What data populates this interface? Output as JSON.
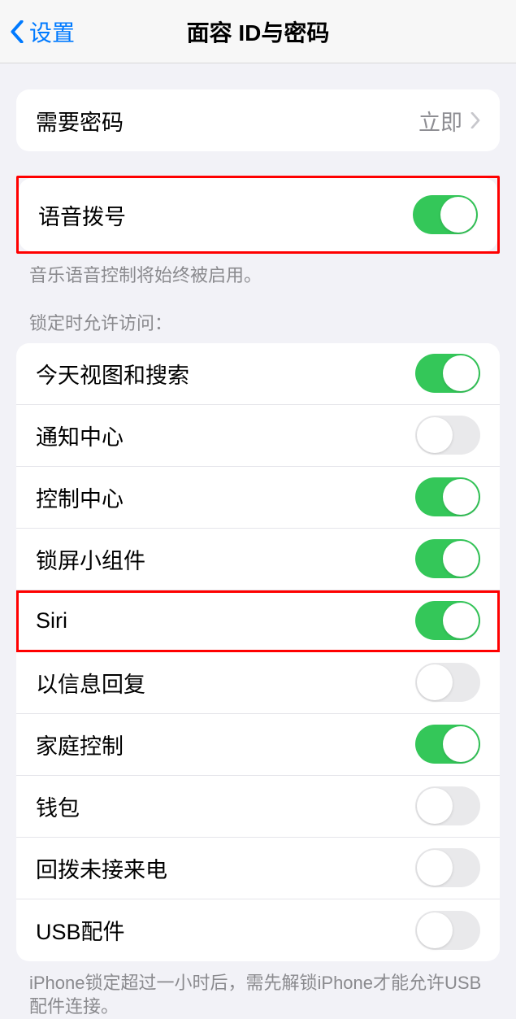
{
  "header": {
    "back_label": "设置",
    "title": "面容 ID与密码"
  },
  "passcode_row": {
    "label": "需要密码",
    "value": "立即"
  },
  "voice_dial": {
    "label": "语音拨号",
    "on": true,
    "footer": "音乐语音控制将始终被启用。"
  },
  "lockscreen": {
    "section_header": "锁定时允许访问：",
    "items": [
      {
        "label": "今天视图和搜索",
        "on": true,
        "highlight": false
      },
      {
        "label": "通知中心",
        "on": false,
        "highlight": false
      },
      {
        "label": "控制中心",
        "on": true,
        "highlight": false
      },
      {
        "label": "锁屏小组件",
        "on": true,
        "highlight": false
      },
      {
        "label": "Siri",
        "on": true,
        "highlight": true
      },
      {
        "label": "以信息回复",
        "on": false,
        "highlight": false
      },
      {
        "label": "家庭控制",
        "on": true,
        "highlight": false
      },
      {
        "label": "钱包",
        "on": false,
        "highlight": false
      },
      {
        "label": "回拨未接来电",
        "on": false,
        "highlight": false
      },
      {
        "label": "USB配件",
        "on": false,
        "highlight": false
      }
    ],
    "footer": "iPhone锁定超过一小时后，需先解锁iPhone才能允许USB配件连接。"
  }
}
